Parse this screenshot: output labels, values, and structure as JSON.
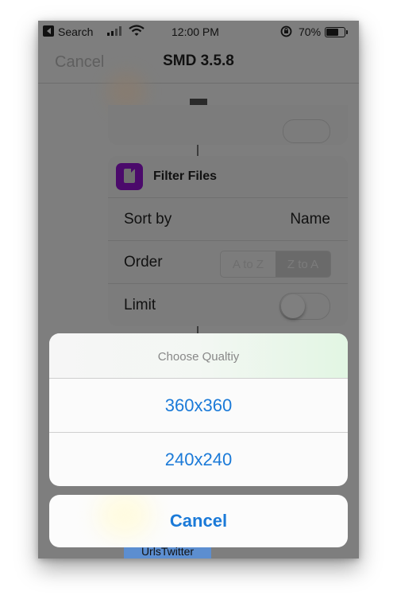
{
  "status_bar": {
    "back_app": "Search",
    "time": "12:00 PM",
    "battery_percent": "70%",
    "battery_level": 0.7,
    "icons": [
      "back-arrow-icon",
      "cellular-signal-icon",
      "wifi-icon",
      "rotation-lock-icon",
      "battery-icon"
    ]
  },
  "nav": {
    "cancel_label": "Cancel",
    "title": "SMD 3.5.8"
  },
  "toolbar": {
    "stop_icon": "stop-icon"
  },
  "filter_action": {
    "icon": "file-icon",
    "title": "Filter Files",
    "rows": {
      "sort_by": {
        "label": "Sort by",
        "value": "Name"
      },
      "order": {
        "label": "Order",
        "options": [
          "A to Z",
          "Z to A"
        ],
        "selected": "Z to A"
      },
      "limit": {
        "label": "Limit",
        "enabled": false
      }
    }
  },
  "bottom_variable": {
    "label": "UrlsTwitter"
  },
  "action_sheet": {
    "title": "Choose Qualtiy",
    "options": [
      "360x360",
      "240x240"
    ],
    "cancel_label": "Cancel"
  },
  "colors": {
    "accent": "#1b7ad8",
    "shortcut_icon": "#4b0a6b",
    "overlay_dim": "#7e7e7e"
  }
}
